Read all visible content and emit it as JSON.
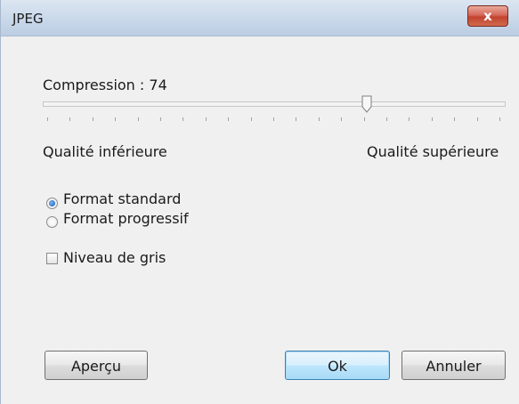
{
  "window": {
    "title": "JPEG",
    "close_glyph": "x"
  },
  "compression": {
    "label": "Compression : 74",
    "value": 74,
    "min": 0,
    "max": 100
  },
  "quality_labels": {
    "low": "Qualité inférieure",
    "high": "Qualité supérieure"
  },
  "format": {
    "options": [
      {
        "label": "Format standard",
        "selected": true
      },
      {
        "label": "Format progressif",
        "selected": false
      }
    ]
  },
  "grayscale": {
    "label": "Niveau de gris",
    "checked": false
  },
  "buttons": {
    "preview": "Aperçu",
    "ok": "Ok",
    "cancel": "Annuler"
  },
  "icons": {
    "close": "close-icon",
    "slider_thumb": "slider-thumb-icon"
  }
}
